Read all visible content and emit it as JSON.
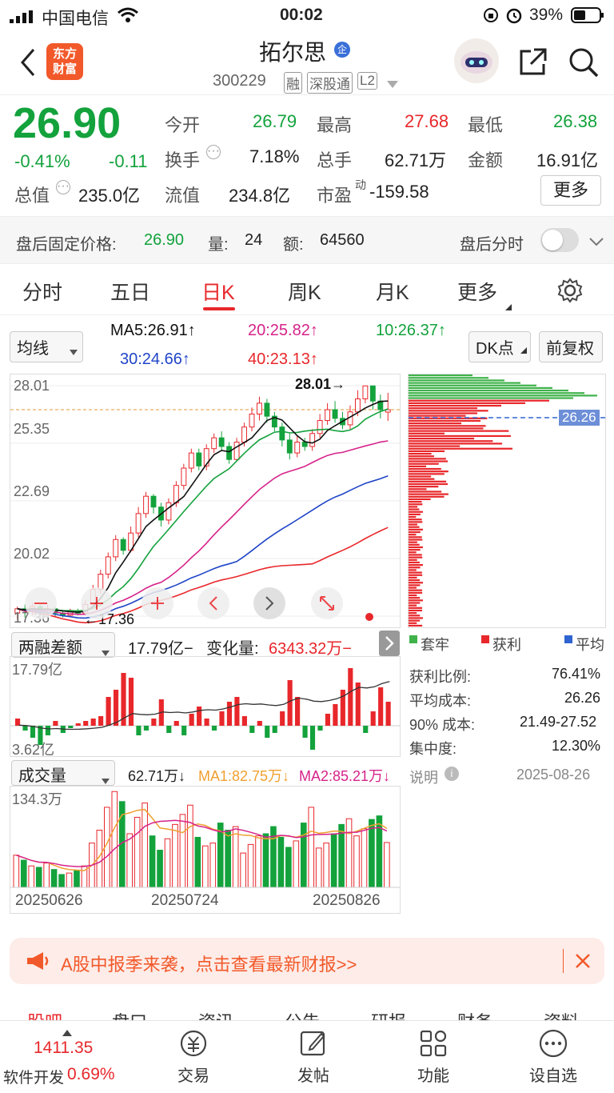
{
  "status_bar": {
    "carrier": "中国电信",
    "time": "00:02",
    "battery": "39%"
  },
  "header": {
    "logo_text": "东方\n财富",
    "stock_name": "拓尔思",
    "enterprise_badge": "企",
    "stock_code": "300229",
    "tags": [
      "融",
      "深股通",
      "L2"
    ]
  },
  "quote": {
    "price": "26.90",
    "change_pct": "-0.41%",
    "change": "-0.11",
    "open_label": "今开",
    "open": "26.79",
    "high_label": "最高",
    "high": "27.68",
    "low_label": "最低",
    "low": "26.38",
    "turnover_label": "换手",
    "turnover": "7.18%",
    "volume_label": "总手",
    "volume": "62.71万",
    "amount_label": "金额",
    "amount": "16.91亿",
    "mktcap_label": "总值",
    "mktcap": "235.0亿",
    "float_label": "流值",
    "float": "234.8亿",
    "pe_label": "市盈",
    "pe_sup": "动",
    "pe": "-159.58",
    "more_label": "更多"
  },
  "after_hours": {
    "label": "盘后固定价格:",
    "price": "26.90",
    "qty_label": "量:",
    "qty": "24",
    "amt_label": "额:",
    "amt": "64560",
    "toggle_label": "盘后分时"
  },
  "tabs": [
    "分时",
    "五日",
    "日K",
    "周K",
    "月K",
    "更多"
  ],
  "active_tab": "日K",
  "ma_bar": {
    "selector": "均线",
    "ma5": "MA5:26.91↑",
    "ma20": "20:25.82↑",
    "ma10": "10:26.37↑",
    "ma30": "30:24.66↑",
    "ma40": "40:23.13↑",
    "dk_label": "DK点",
    "adjust_label": "前复权"
  },
  "kline": {
    "y_labels": [
      "28.01",
      "25.35",
      "22.69",
      "20.02",
      "17.36"
    ],
    "high_marker": "28.01→",
    "low_marker": "←17.36",
    "dist_price": "26.26",
    "colors": {
      "up": "#e8272b",
      "down": "#13a23c",
      "ma5": "#111111",
      "ma10": "#13a23c",
      "ma20": "#d6238a",
      "ma30": "#1f45c8",
      "ma40": "#e8272b"
    }
  },
  "margin_panel": {
    "selector": "两融差额",
    "value": "17.79亿−",
    "change_label": "变化量:",
    "change": "6343.32万−",
    "top_label": "17.79亿",
    "bottom_label": "3.62亿"
  },
  "volume_panel": {
    "selector": "成交量",
    "vol": "62.71万↓",
    "ma1": "MA1:82.75万↓",
    "ma2": "MA2:85.21万↓",
    "top_label": "134.3万",
    "dates": [
      "20250626",
      "20250724",
      "20250826"
    ]
  },
  "distribution": {
    "legend": [
      "套牢",
      "获利",
      "平均"
    ],
    "rows": [
      {
        "label": "获利比例:",
        "value": "76.41%"
      },
      {
        "label": "平均成本:",
        "value": "26.26"
      },
      {
        "label": "90% 成本:",
        "value": "21.49-27.52"
      },
      {
        "label": "集中度:",
        "value": "12.30%"
      }
    ],
    "note_label": "说明",
    "note_date": "2025-08-26"
  },
  "banner": {
    "text": "A股中报季来袭，点击查看最新财报>>"
  },
  "bottom_tabs": [
    "股吧",
    "盘口",
    "资讯",
    "公告",
    "研报",
    "财务",
    "资料"
  ],
  "footer": {
    "index_value": "1411.35",
    "index_name": "软件开发",
    "index_change": "0.69%",
    "items": [
      "交易",
      "发帖",
      "功能",
      "设自选"
    ]
  },
  "chart_data": [
    {
      "type": "candlestick",
      "title": "日K",
      "ylim": [
        17.36,
        28.01
      ],
      "y_ticks": [
        28.01,
        25.35,
        22.69,
        20.02,
        17.36
      ],
      "candles": [
        [
          17.5,
          17.7,
          17.2,
          17.8
        ],
        [
          17.7,
          17.6,
          17.3,
          17.9
        ],
        [
          17.6,
          17.8,
          17.4,
          18.0
        ],
        [
          17.8,
          17.6,
          17.3,
          17.9
        ],
        [
          17.6,
          17.7,
          17.4,
          17.9
        ],
        [
          17.7,
          17.5,
          17.3,
          17.8
        ],
        [
          17.5,
          17.4,
          17.3,
          17.6
        ],
        [
          17.4,
          17.6,
          17.36,
          17.7
        ],
        [
          17.6,
          17.5,
          17.4,
          17.7
        ],
        [
          17.5,
          17.9,
          17.4,
          18.1
        ],
        [
          17.9,
          18.6,
          17.8,
          18.8
        ],
        [
          18.6,
          19.3,
          18.4,
          19.5
        ],
        [
          19.3,
          20.1,
          19.1,
          20.3
        ],
        [
          20.1,
          20.9,
          19.9,
          21.1
        ],
        [
          20.9,
          20.4,
          20.2,
          21.0
        ],
        [
          20.4,
          21.2,
          20.3,
          21.5
        ],
        [
          21.2,
          22.1,
          21.0,
          22.4
        ],
        [
          22.1,
          22.9,
          21.9,
          23.1
        ],
        [
          22.9,
          22.4,
          22.1,
          23.0
        ],
        [
          22.4,
          21.8,
          21.5,
          22.6
        ],
        [
          21.8,
          22.6,
          21.6,
          22.8
        ],
        [
          22.6,
          23.4,
          22.4,
          23.6
        ],
        [
          23.4,
          24.2,
          23.2,
          24.4
        ],
        [
          24.2,
          24.9,
          24.0,
          25.1
        ],
        [
          24.9,
          24.3,
          24.1,
          25.1
        ],
        [
          24.3,
          25.1,
          24.1,
          25.3
        ],
        [
          25.1,
          25.6,
          24.9,
          25.8
        ],
        [
          25.6,
          25.2,
          25.0,
          25.9
        ],
        [
          25.2,
          24.6,
          24.4,
          25.4
        ],
        [
          24.6,
          25.4,
          24.5,
          25.6
        ],
        [
          25.4,
          26.1,
          25.2,
          26.3
        ],
        [
          26.1,
          26.7,
          25.9,
          27.0
        ],
        [
          26.7,
          27.2,
          26.4,
          27.5
        ],
        [
          27.2,
          26.6,
          26.3,
          27.4
        ],
        [
          26.6,
          26.1,
          25.9,
          26.8
        ],
        [
          26.1,
          25.5,
          25.2,
          26.3
        ],
        [
          25.5,
          24.9,
          24.6,
          25.8
        ],
        [
          24.9,
          25.4,
          24.7,
          25.7
        ],
        [
          25.4,
          25.2,
          25.0,
          25.6
        ],
        [
          25.2,
          25.8,
          25.0,
          26.0
        ],
        [
          25.8,
          26.4,
          25.6,
          26.7
        ],
        [
          26.4,
          26.9,
          26.2,
          27.2
        ],
        [
          26.9,
          26.5,
          26.3,
          27.3
        ],
        [
          26.5,
          26.2,
          26.0,
          26.8
        ],
        [
          26.2,
          26.8,
          26.0,
          27.1
        ],
        [
          26.8,
          27.4,
          26.6,
          27.8
        ],
        [
          27.4,
          28.0,
          27.2,
          28.01
        ],
        [
          28.0,
          27.3,
          26.9,
          28.01
        ],
        [
          27.3,
          26.9,
          26.5,
          27.6
        ],
        [
          26.79,
          26.9,
          26.38,
          27.68
        ]
      ]
    },
    {
      "type": "bar",
      "title": "两融差额",
      "ylim": [
        3.62,
        17.79
      ],
      "values": [
        0.3,
        -0.2,
        -0.5,
        -0.8,
        -0.4,
        0.2,
        -0.3,
        -0.1,
        0.1,
        0.2,
        0.3,
        0.4,
        1.2,
        1.5,
        2.2,
        2.0,
        -0.4,
        -0.2,
        0.3,
        1.1,
        -0.3,
        0.2,
        -0.4,
        0.5,
        0.8,
        0.3,
        -0.2,
        0.6,
        1.0,
        1.2,
        0.4,
        -0.3,
        0.2,
        -0.5,
        -0.3,
        0.6,
        1.9,
        1.2,
        -0.5,
        -1.0,
        -0.2,
        0.5,
        0.9,
        1.5,
        2.4,
        1.8,
        -0.3,
        0.6,
        1.6,
        1.0
      ]
    },
    {
      "type": "bar",
      "title": "成交量",
      "ylim": [
        0,
        134.3
      ],
      "values": [
        45,
        38,
        30,
        28,
        34,
        25,
        18,
        20,
        24,
        30,
        62,
        80,
        112,
        134,
        120,
        75,
        98,
        118,
        72,
        52,
        68,
        88,
        102,
        115,
        70,
        58,
        62,
        90,
        80,
        85,
        48,
        60,
        72,
        75,
        85,
        70,
        56,
        65,
        90,
        112,
        55,
        62,
        75,
        88,
        96,
        72,
        82,
        95,
        100,
        62.71
      ],
      "dates": [
        "20250626",
        "20250724",
        "20250826"
      ]
    }
  ]
}
